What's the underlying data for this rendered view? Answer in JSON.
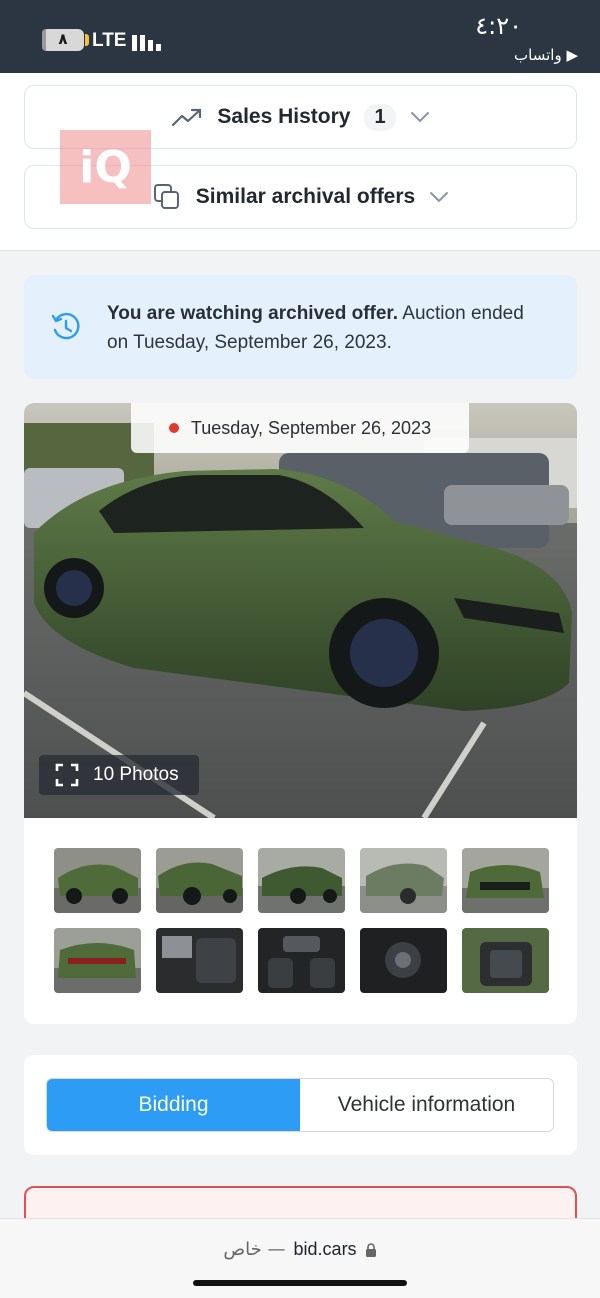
{
  "status_bar": {
    "battery": "٨",
    "network": "LTE",
    "time": "٤:٢٠",
    "back_app": "▶ واتساب"
  },
  "accordions": {
    "sales_history_label": "Sales History",
    "sales_history_count": "1",
    "similar_label": "Similar archival offers"
  },
  "watermark": "iQ",
  "banner": {
    "bold": "You are watching archived offer.",
    "rest": " Auction ended on Tuesday, September 26, 2023."
  },
  "gallery": {
    "date": "Tuesday, September 26, 2023",
    "photos_button": "10 Photos",
    "thumbnail_count": 10
  },
  "tabs": {
    "bidding": "Bidding",
    "vehicle_info": "Vehicle information"
  },
  "browser": {
    "private_label": "خاص —",
    "domain": "bid.cars"
  },
  "colors": {
    "status_bar": "#2c3642",
    "accent": "#2d9cf5",
    "banner_bg": "#e4f1fd",
    "alert_border": "#e05252"
  }
}
